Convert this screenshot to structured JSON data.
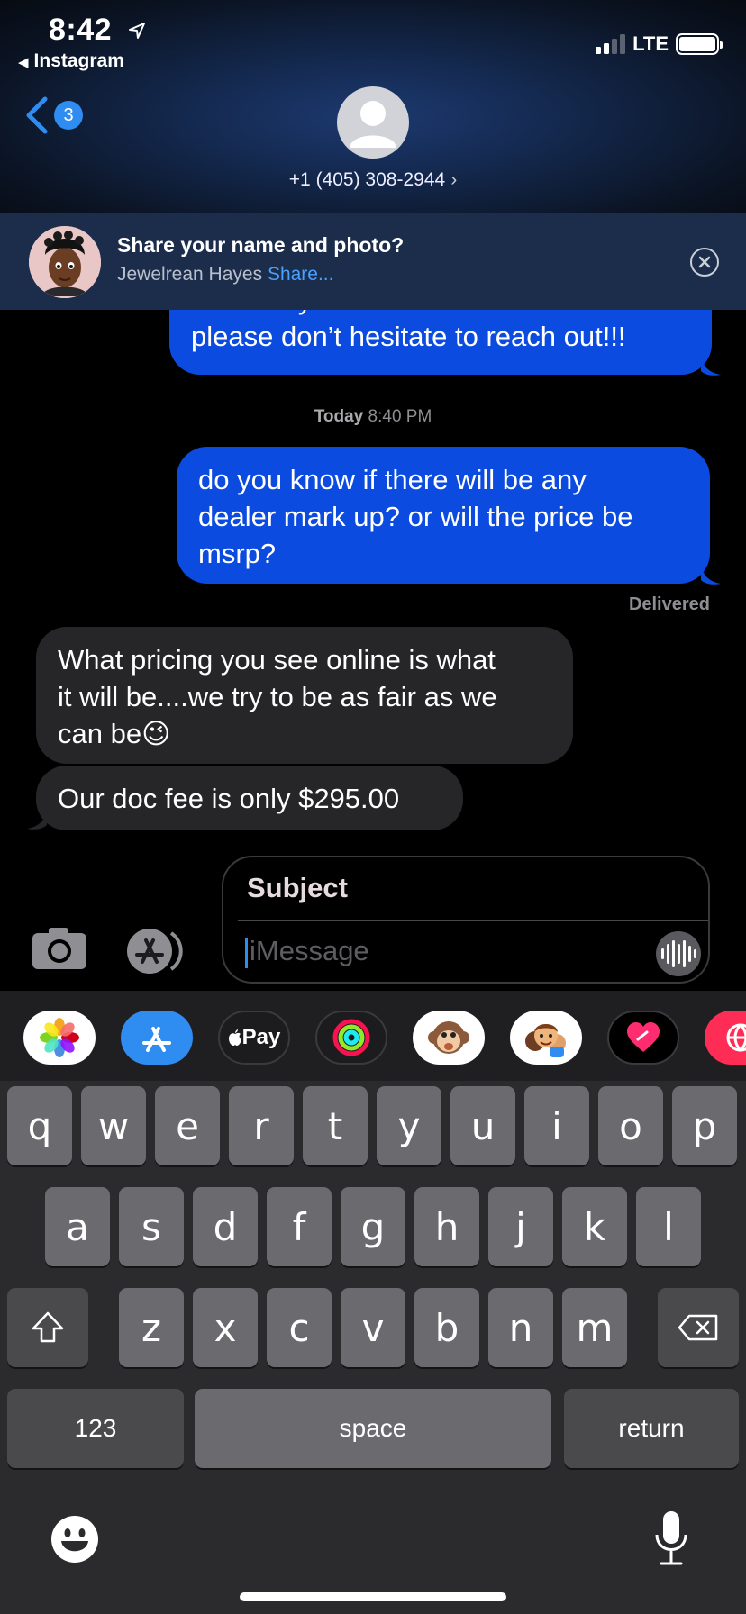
{
  "status_bar": {
    "time": "8:42",
    "back_app": "Instagram",
    "network": "LTE"
  },
  "header": {
    "unread_count": "3",
    "contact_number": "+1 (405) 308-2944",
    "contact_chevron": "›"
  },
  "share_banner": {
    "title": "Share your name and photo?",
    "name": "Jewelrean Hayes",
    "share_link": "Share..."
  },
  "messages": {
    "clipped_outgoing": {
      "line1": "the safety tech that it come with it",
      "line2": "please don’t hesitate to reach out!!!"
    },
    "timestamp_day": "Today",
    "timestamp_time": "8:40 PM",
    "outgoing_1": {
      "line1": "do you know if there will be any",
      "line2": "dealer mark up? or will the price be",
      "line3": "msrp?"
    },
    "delivered": "Delivered",
    "incoming_1": {
      "line1": "What pricing you see online is what",
      "line2": "it will be....we try to be as fair as we",
      "line3": "can be",
      "emoji": "😉"
    },
    "incoming_2": "Our doc fee is only $295.00"
  },
  "compose": {
    "subject_placeholder": "Subject",
    "message_placeholder": "iMessage"
  },
  "app_strip": {
    "applepay_label": " Pay"
  },
  "keyboard": {
    "row1": [
      "q",
      "w",
      "e",
      "r",
      "t",
      "y",
      "u",
      "i",
      "o",
      "p"
    ],
    "row2": [
      "a",
      "s",
      "d",
      "f",
      "g",
      "h",
      "j",
      "k",
      "l"
    ],
    "row3": [
      "z",
      "x",
      "c",
      "v",
      "b",
      "n",
      "m"
    ],
    "numbers_label": "123",
    "space_label": "space",
    "return_label": "return"
  },
  "colors": {
    "outgoing_bubble": "#0b4be0",
    "incoming_bubble": "#262628",
    "accent": "#2f8cf1"
  }
}
